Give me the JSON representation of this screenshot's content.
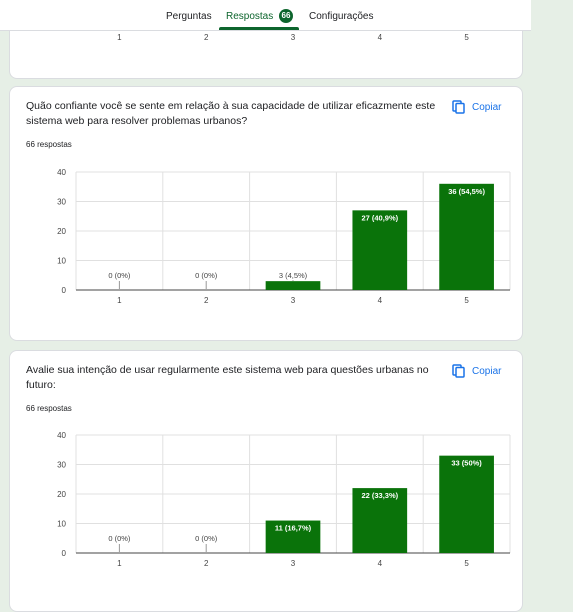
{
  "tabs": [
    {
      "label": "Perguntas"
    },
    {
      "label": "Respostas",
      "badge": "66",
      "active": true
    },
    {
      "label": "Configurações"
    }
  ],
  "copy_label": "Copiar",
  "colors": {
    "bar": "#0a730a",
    "accent": "#0d652d",
    "link": "#1a73e8"
  },
  "partial_chart": {
    "categories": [
      "1",
      "2",
      "3",
      "4",
      "5"
    ]
  },
  "cards": [
    {
      "question": "Quão confiante você se sente em relação à sua capacidade de utilizar eficazmente este sistema web para resolver problemas urbanos?",
      "responses": "66 respostas"
    },
    {
      "question": "Avalie sua intenção de usar regularmente este sistema web para questões urbanas no futuro:",
      "responses": "66 respostas"
    }
  ],
  "chart_data": [
    {
      "type": "bar",
      "categories": [
        "1",
        "2",
        "3",
        "4",
        "5"
      ],
      "values": [
        0,
        0,
        3,
        27,
        36
      ],
      "data_labels": [
        "0 (0%)",
        "0 (0%)",
        "3 (4,5%)",
        "27 (40,9%)",
        "36 (54,5%)"
      ],
      "yticks": [
        "0",
        "10",
        "20",
        "30",
        "40"
      ],
      "ylim": [
        0,
        40
      ],
      "grid": true
    },
    {
      "type": "bar",
      "categories": [
        "1",
        "2",
        "3",
        "4",
        "5"
      ],
      "values": [
        0,
        0,
        11,
        22,
        33
      ],
      "data_labels": [
        "0 (0%)",
        "0 (0%)",
        "11 (16,7%)",
        "22 (33,3%)",
        "33 (50%)"
      ],
      "yticks": [
        "0",
        "10",
        "20",
        "30",
        "40"
      ],
      "ylim": [
        0,
        40
      ],
      "grid": true
    }
  ]
}
